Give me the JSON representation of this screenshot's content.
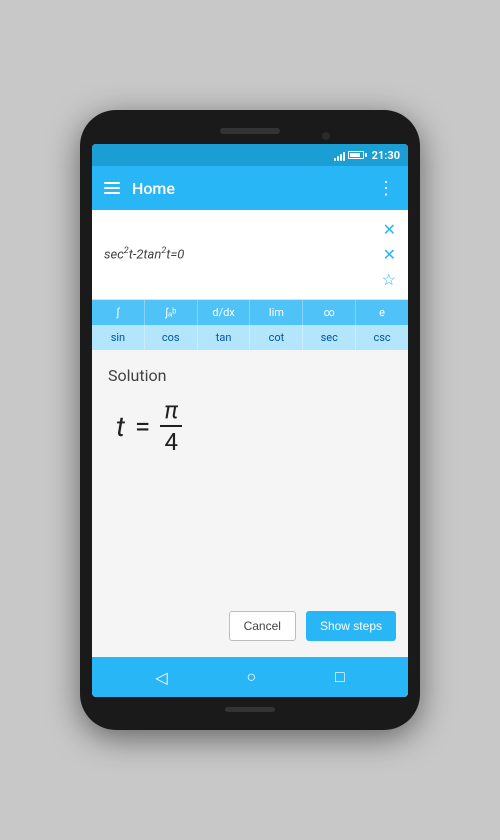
{
  "phone": {
    "status": {
      "time": "21:30",
      "battery_pct": 75
    },
    "app_bar": {
      "title": "Home",
      "more_label": "⋮"
    },
    "input": {
      "equation": "sec²t-2tan²t=0",
      "placeholder": ""
    },
    "keyboard": {
      "row1": [
        "∫",
        "∫ₐᵇ",
        "d/dx",
        "lim",
        "∞",
        "e"
      ],
      "row2": [
        "sin",
        "cos",
        "tan",
        "cot",
        "sec",
        "csc"
      ]
    },
    "solution": {
      "label": "Solution",
      "variable": "t",
      "equals": "=",
      "numerator": "π",
      "denominator": "4"
    },
    "buttons": {
      "cancel": "Cancel",
      "show_steps": "Show steps"
    },
    "nav": {
      "back": "◁",
      "home": "○",
      "recent": "□"
    }
  }
}
